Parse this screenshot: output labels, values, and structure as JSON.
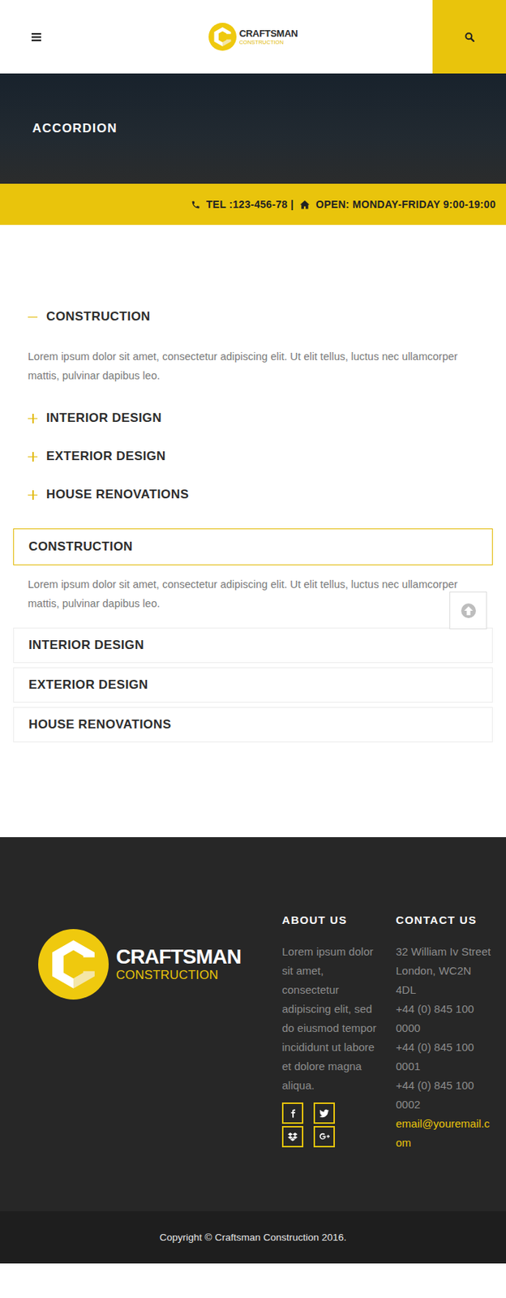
{
  "header": {
    "logo": {
      "name": "CRAFTSMAN",
      "tagline": "CONSTRUCTION"
    }
  },
  "page_title": "ACCORDION",
  "info_bar": {
    "tel": "TEL :123-456-78 |",
    "hours": "OPEN: MONDAY-FRIDAY 9:00-19:00"
  },
  "accordion_plain": [
    {
      "title": "CONSTRUCTION",
      "expanded": true,
      "body": "Lorem ipsum dolor sit amet, consectetur adipiscing elit. Ut elit tellus, luctus nec ullamcorper mattis, pulvinar dapibus leo."
    },
    {
      "title": "INTERIOR DESIGN",
      "expanded": false
    },
    {
      "title": "EXTERIOR DESIGN",
      "expanded": false
    },
    {
      "title": "HOUSE RENOVATIONS",
      "expanded": false
    }
  ],
  "accordion_boxed": [
    {
      "title": "CONSTRUCTION",
      "expanded": true,
      "body": "Lorem ipsum dolor sit amet, consectetur adipiscing elit. Ut elit tellus, luctus nec ullamcorper mattis, pulvinar dapibus leo."
    },
    {
      "title": "INTERIOR DESIGN",
      "expanded": false
    },
    {
      "title": "EXTERIOR DESIGN",
      "expanded": false
    },
    {
      "title": "HOUSE RENOVATIONS",
      "expanded": false
    }
  ],
  "footer": {
    "logo": {
      "name": "CRAFTSMAN",
      "tagline": "CONSTRUCTION"
    },
    "about": {
      "heading": "ABOUT US",
      "text": "Lorem ipsum dolor sit amet, consectetur adipiscing elit, sed do eiusmod tempor incididunt ut labore et dolore magna aliqua."
    },
    "contact": {
      "heading": "CONTACT US",
      "address": "32 William Iv Street London, WC2N 4DL",
      "phones": [
        "+44 (0) 845 100 0000",
        "+44 (0) 845 100 0001",
        "+44 (0) 845 100 0002"
      ],
      "email": "email@youremail.com"
    }
  },
  "copyright": "Copyright © Craftsman Construction 2016."
}
